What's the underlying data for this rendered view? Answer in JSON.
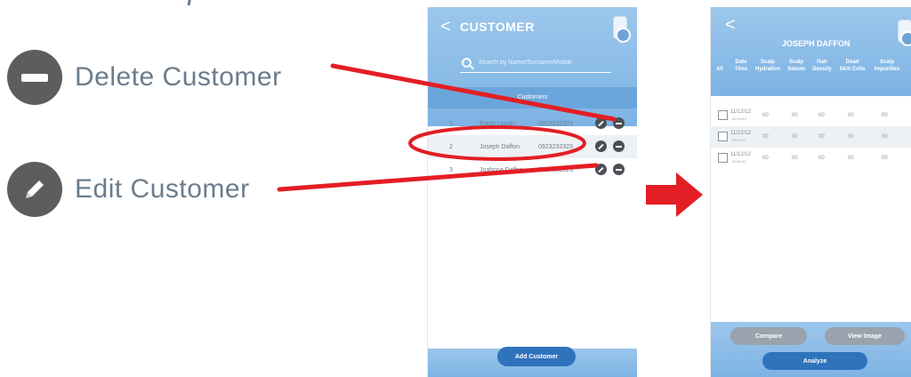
{
  "legend": {
    "delete_label": "Delete Customer",
    "edit_label": "Edit Customer"
  },
  "customer_screen": {
    "title": "CUSTOMER",
    "back_glyph": "<",
    "search_placeholder": "Search by Name/Surname/Mobile",
    "section_title": "Customers",
    "rows": [
      {
        "num": "1",
        "name": "Franz Locsin",
        "mobile": "0923232323"
      },
      {
        "num": "2",
        "name": "Joseph Daffon",
        "mobile": "0923232323"
      },
      {
        "num": "3",
        "name": "Joahnna Daffon",
        "mobile": "0923232323"
      }
    ],
    "add_button": "Add Customer"
  },
  "detail_screen": {
    "back_glyph": "<",
    "title": "JOSEPH DAFFON",
    "columns": {
      "all": "All",
      "date_time": "Date\nTime",
      "scalp_hydration": "Scalp\nHydration",
      "scalp_sebum": "Scalp\nSebum",
      "hair_density": "Hair\nDensity",
      "dead_skin_cells": "Dead\nSkin Cells",
      "scalp_impurities": "Scalp\nImpurities"
    },
    "records": [
      {
        "date": "11/12/12",
        "time": "02:03:20",
        "v1": "00",
        "v2": "00",
        "v3": "00",
        "v4": "00",
        "v5": "00"
      },
      {
        "date": "11/12/12",
        "time": "02:03:20",
        "v1": "00",
        "v2": "00",
        "v3": "00",
        "v4": "00",
        "v5": "00"
      },
      {
        "date": "11/12/12",
        "time": "02:03:20",
        "v1": "00",
        "v2": "00",
        "v3": "00",
        "v4": "00",
        "v5": "00"
      }
    ],
    "compare_button": "Compare",
    "view_image_button": "View Image",
    "analyze_button": "Analyze"
  },
  "colors": {
    "annotation_red": "#e31e24",
    "header_blue": "#8dbde8",
    "button_blue": "#2f73bd",
    "icon_dark": "#4a4f55"
  },
  "icons": {
    "delete": "minus-circle-icon",
    "edit": "pencil-circle-icon",
    "search": "search-icon",
    "back": "chevron-left-icon",
    "transition": "arrow-right-icon"
  }
}
